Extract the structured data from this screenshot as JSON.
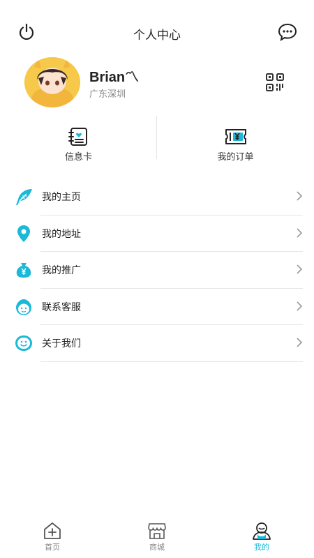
{
  "header": {
    "title": "个人中心",
    "left_icon": "power-icon",
    "right_icon": "chat-bubble-icon"
  },
  "profile": {
    "username": "Brian〽",
    "location": "广东深圳",
    "qr_icon": "qr-code-icon"
  },
  "shortcuts": [
    {
      "label": "信息卡",
      "icon": "info-card-icon"
    },
    {
      "label": "我的订单",
      "icon": "order-ticket-icon"
    }
  ],
  "menu": [
    {
      "label": "我的主页",
      "icon": "feather-icon"
    },
    {
      "label": "我的地址",
      "icon": "location-pin-icon"
    },
    {
      "label": "我的推广",
      "icon": "money-bag-icon"
    },
    {
      "label": "联系客服",
      "icon": "customer-service-icon"
    },
    {
      "label": "关于我们",
      "icon": "smiley-icon"
    }
  ],
  "tabbar": [
    {
      "label": "首页",
      "icon": "home-add-icon",
      "active": false
    },
    {
      "label": "商城",
      "icon": "store-icon",
      "active": false
    },
    {
      "label": "我的",
      "icon": "user-profile-icon",
      "active": true
    }
  ],
  "colors": {
    "accent": "#1bb8d8",
    "text": "#222222",
    "muted": "#888888",
    "divider": "#e6e6e6"
  }
}
